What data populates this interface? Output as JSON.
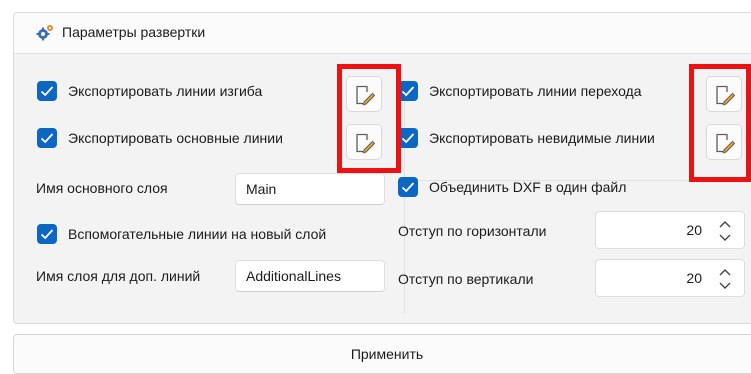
{
  "section": {
    "title": "Параметры развертки",
    "icon": "gear-icon"
  },
  "left": {
    "export_bend_lines": {
      "label": "Экспортировать линии изгиба",
      "checked": true
    },
    "export_main_lines": {
      "label": "Экспортировать основные линии",
      "checked": true
    },
    "main_layer": {
      "label": "Имя основного слоя",
      "value": "Main"
    },
    "aux_new_layer": {
      "label": "Вспомогательные линии на новый слой",
      "checked": true
    },
    "aux_layer": {
      "label": "Имя слоя для доп. линий",
      "value": "AdditionalLines"
    }
  },
  "right": {
    "export_transition_lines": {
      "label": "Экспортировать линии перехода",
      "checked": true
    },
    "export_hidden_lines": {
      "label": "Экспортировать невидимые линии",
      "checked": true
    },
    "merge_dxf": {
      "label": "Объединить DXF в один файл",
      "checked": true
    },
    "offset_h": {
      "label": "Отступ по горизонтали",
      "value": "20"
    },
    "offset_v": {
      "label": "Отступ по вертикали",
      "value": "20"
    }
  },
  "apply_label": "Применить",
  "colors": {
    "accent": "#0b67c2",
    "highlight": "#ee1111"
  }
}
